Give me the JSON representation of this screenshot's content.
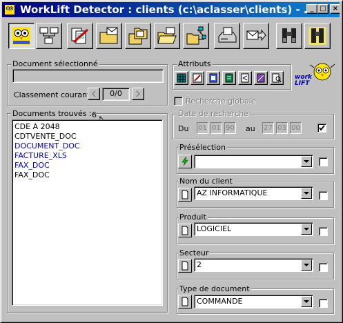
{
  "window": {
    "title": "WorkLift Detector : clients (c:\\aclasser\\clients) - ...",
    "minimize_label": "_",
    "maximize_label": "□",
    "close_label": "×"
  },
  "toolbar": {
    "buttons": [
      "owl-logo",
      "network",
      "documents-delete",
      "folder-mail",
      "folders",
      "folder-open",
      "tree-export",
      "fax",
      "mail-send",
      "binoculars",
      "binoculars-all"
    ]
  },
  "selected_doc": {
    "group_label": "Document sélectionné",
    "value": "",
    "classement_label": "Classement courant :",
    "counter": "0/0"
  },
  "found_docs": {
    "group_label": "Documents trouvés :",
    "count": "6",
    "items": [
      {
        "label": "CDE A 2048",
        "color": "#000000"
      },
      {
        "label": "CDTVENTE_DOC",
        "color": "#000000"
      },
      {
        "label": "DOCUMENT_DOC",
        "color": "#0000c0"
      },
      {
        "label": "FACTURE_XLS",
        "color": "#0000c0"
      },
      {
        "label": "FAX_DOC",
        "color": "#0000c0"
      },
      {
        "label": "FAX_DOC",
        "color": "#000000"
      }
    ]
  },
  "attributes": {
    "group_label": "Attributs",
    "global_search_label": "Recherche globale",
    "brand_text": "work LIFT"
  },
  "date_search": {
    "group_label": "Date de recherche",
    "from_label": "Du",
    "to_label": "au",
    "from": [
      "01",
      "01",
      "90"
    ],
    "to": [
      "27",
      "03",
      "00"
    ],
    "checked": true
  },
  "filters": [
    {
      "label": "Présélection",
      "value": ""
    },
    {
      "label": "Nom du client",
      "value": "AZ INFORMATIQUE"
    },
    {
      "label": "Produit",
      "value": "LOGICIEL"
    },
    {
      "label": "Secteur",
      "value": "2"
    },
    {
      "label": "Type de document",
      "value": "COMMANDE"
    }
  ]
}
